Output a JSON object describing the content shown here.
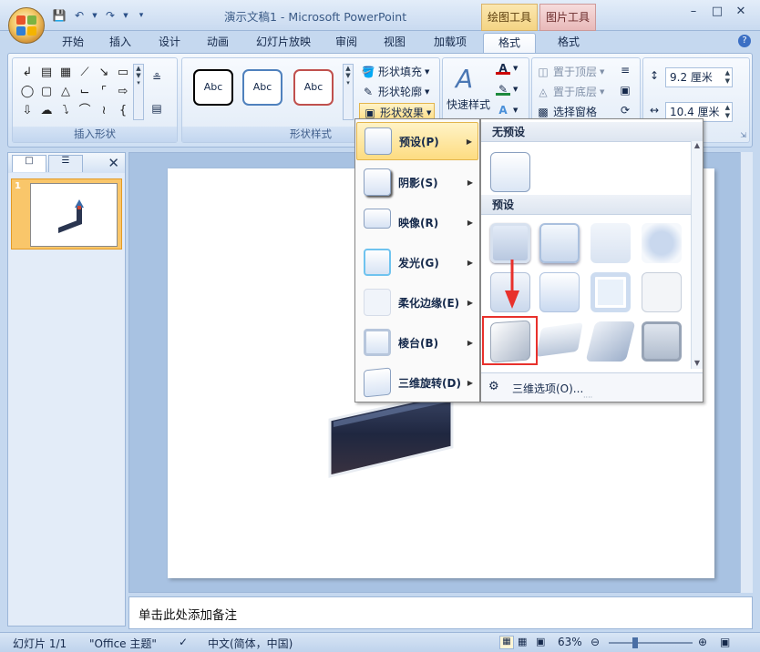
{
  "titlebar": {
    "title": "演示文稿1 - Microsoft PowerPoint",
    "contextual_tab_drawing": "绘图工具",
    "contextual_tab_picture": "图片工具"
  },
  "tabs": [
    {
      "label": "开始"
    },
    {
      "label": "插入"
    },
    {
      "label": "设计"
    },
    {
      "label": "动画"
    },
    {
      "label": "幻灯片放映"
    },
    {
      "label": "审阅"
    },
    {
      "label": "视图"
    },
    {
      "label": "加载项"
    },
    {
      "label": "格式"
    },
    {
      "label": "格式"
    }
  ],
  "ribbon": {
    "group_insert_shapes": "插入形状",
    "group_shape_styles": "形状样式",
    "style_samples": [
      "Abc",
      "Abc",
      "Abc"
    ],
    "shape_fill": "形状填充",
    "shape_outline": "形状轮廓",
    "shape_effects": "形状效果",
    "quick_styles": "快速样式",
    "bring_to_front": "置于顶层",
    "send_to_back": "置于底层",
    "selection_pane": "选择窗格",
    "height_value": "9.2 厘米",
    "width_value": "10.4 厘米"
  },
  "effects_menu": {
    "items": [
      {
        "label": "预设(P)"
      },
      {
        "label": "阴影(S)"
      },
      {
        "label": "映像(R)"
      },
      {
        "label": "发光(G)"
      },
      {
        "label": "柔化边缘(E)"
      },
      {
        "label": "棱台(B)"
      },
      {
        "label": "三维旋转(D)"
      }
    ]
  },
  "preset_submenu": {
    "no_preset_header": "无预设",
    "preset_header": "预设",
    "options_label": "三维选项(O)..."
  },
  "left_panel": {
    "slide_number": "1"
  },
  "notes": {
    "placeholder": "单击此处添加备注"
  },
  "statusbar": {
    "slide_info": "幻灯片 1/1",
    "theme": "\"Office 主题\"",
    "language": "中文(简体，中国)",
    "zoom": "63%"
  },
  "colors": {
    "ribbon_bg": "#dbe7f6",
    "menu_highlight": "#fddc81",
    "red_highlight": "#e8312c",
    "red_arrow": "#e8312c"
  }
}
